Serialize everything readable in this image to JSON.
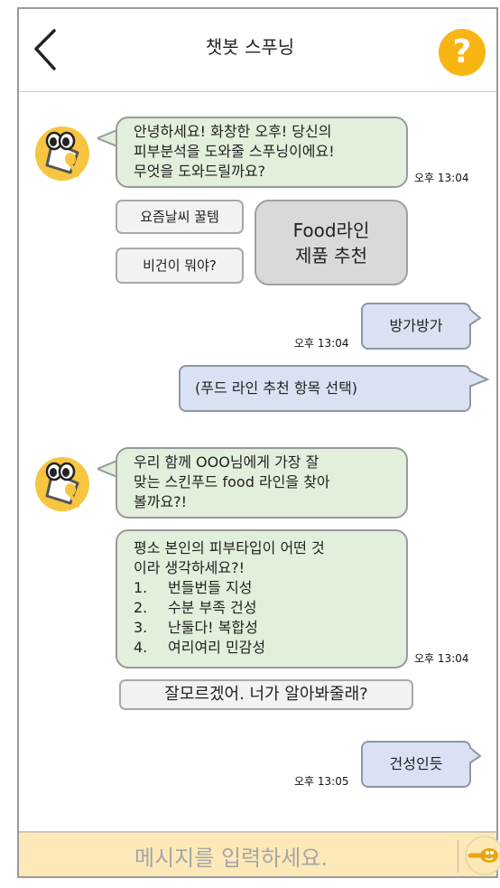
{
  "header": {
    "title": "챗봇 스푸닝",
    "help_label": "?"
  },
  "messages": {
    "bot1": {
      "lines": [
        "안녕하세요! 화창한 오후! 당신의",
        "피부분석을 도와줄 스푸닝이에요!",
        "무엇을 도와드릴까요?"
      ],
      "time": "오후 13:04"
    },
    "quick_replies": {
      "chip1": "요즘날씨 꿀템",
      "chip2": "비건이 뭐야?",
      "big_line1": "Food라인",
      "big_line2": "제품 추천"
    },
    "user1": {
      "text": "방가방가",
      "time": "오후 13:04"
    },
    "user2": {
      "text": "(푸드 라인 추천 항목 선택)"
    },
    "bot2": {
      "lines": [
        "우리 함께 OOO님에게 가장 잘",
        "맞는 스킨푸드 food 라인을 찾아",
        "볼까요?!"
      ]
    },
    "bot3": {
      "intro1": "평소 본인의 피부타입이 어떤 것",
      "intro2": "이라 생각하세요?!",
      "options": [
        {
          "num": "1.",
          "text": "번들번들 지성"
        },
        {
          "num": "2.",
          "text": "수분 부족 건성"
        },
        {
          "num": "3.",
          "text": "난둘다! 복합성"
        },
        {
          "num": "4.",
          "text": "여리여리 민감성"
        }
      ],
      "time": "오후 13:04"
    },
    "chip_unknown": "잘모르겠어. 너가 알아봐줄래?",
    "user3": {
      "text": "건성인듯",
      "time": "오후 13:05"
    }
  },
  "input": {
    "placeholder": "메시지를 입력하세요."
  },
  "icons": {
    "back": "chevron-left-icon",
    "help": "question-mark-icon",
    "avatar": "spoon-mascot-icon",
    "send": "spoon-send-icon"
  },
  "colors": {
    "accent": "#f7b514",
    "bot_bubble": "#e2efda",
    "user_bubble": "#d9e1f2",
    "input_bar": "#fde9b8"
  }
}
